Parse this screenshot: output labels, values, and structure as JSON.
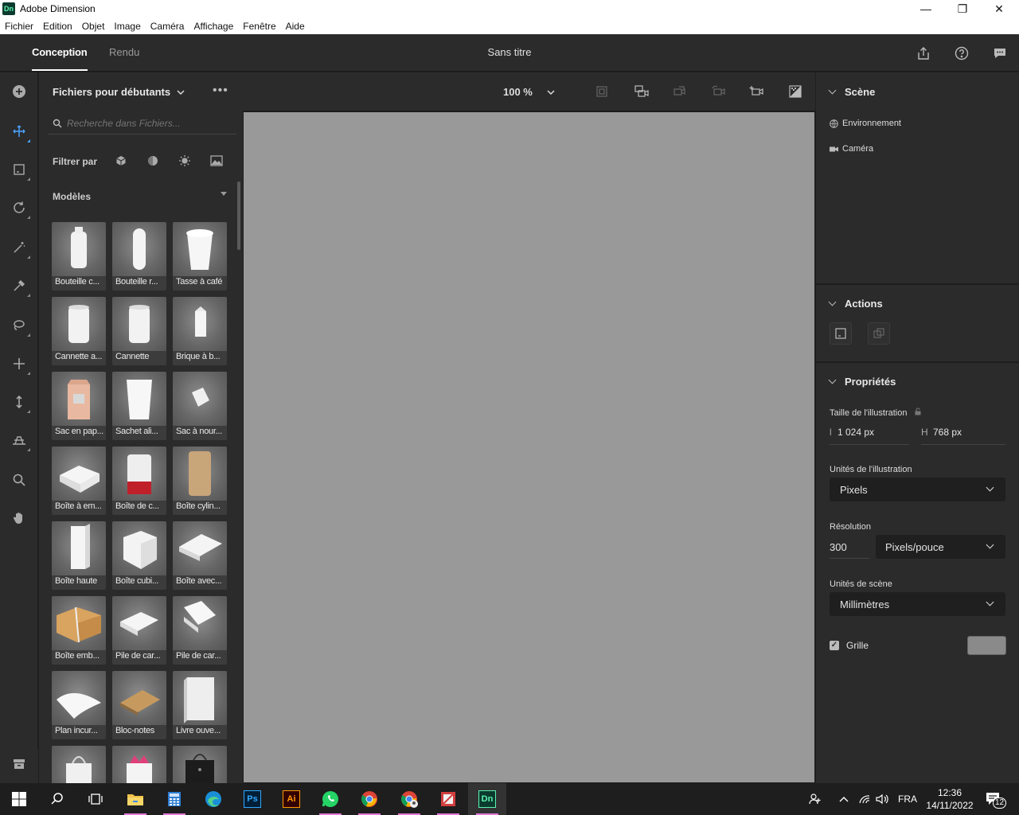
{
  "window": {
    "app_icon": "Dn",
    "title": "Adobe Dimension",
    "minimize_glyph": "—",
    "maximize_glyph": "❐",
    "close_glyph": "✕"
  },
  "menu": [
    "Fichier",
    "Edition",
    "Objet",
    "Image",
    "Caméra",
    "Affichage",
    "Fenêtre",
    "Aide"
  ],
  "header": {
    "tabs": [
      "Conception",
      "Rendu"
    ],
    "document_title": "Sans titre"
  },
  "left_panel": {
    "title": "Fichiers pour débutants",
    "search_placeholder": "Recherche dans Fichiers...",
    "filter_label": "Filtrer par",
    "section": "Modèles",
    "items": [
      {
        "label": "Bouteille c...",
        "shape": "bottle"
      },
      {
        "label": "Bouteille r...",
        "shape": "bottle-round"
      },
      {
        "label": "Tasse à café",
        "shape": "cup"
      },
      {
        "label": "Cannette a...",
        "shape": "can"
      },
      {
        "label": "Cannette",
        "shape": "can"
      },
      {
        "label": "Brique à b...",
        "shape": "carton"
      },
      {
        "label": "Sac en pap...",
        "shape": "paper-bag"
      },
      {
        "label": "Sachet ali...",
        "shape": "pouch"
      },
      {
        "label": "Sac à nour...",
        "shape": "sachet"
      },
      {
        "label": "Boîte à em...",
        "shape": "clamshell"
      },
      {
        "label": "Boîte de c...",
        "shape": "tin"
      },
      {
        "label": "Boîte cylin...",
        "shape": "tube"
      },
      {
        "label": "Boîte haute",
        "shape": "tall-box"
      },
      {
        "label": "Boîte cubi...",
        "shape": "cube"
      },
      {
        "label": "Boîte avec...",
        "shape": "flat-box"
      },
      {
        "label": "Boîte emb...",
        "shape": "parcel"
      },
      {
        "label": "Pile de car...",
        "shape": "cards"
      },
      {
        "label": "Pile de car...",
        "shape": "cards2"
      },
      {
        "label": "Plan incur...",
        "shape": "curved-plane"
      },
      {
        "label": "Bloc-notes",
        "shape": "notepad"
      },
      {
        "label": "Livre ouve...",
        "shape": "book"
      },
      {
        "label": "",
        "shape": "shopping-bag"
      },
      {
        "label": "",
        "shape": "gift-bag"
      },
      {
        "label": "",
        "shape": "black-bag"
      }
    ]
  },
  "viewport": {
    "zoom": "100 %"
  },
  "right_panel": {
    "scene": {
      "title": "Scène",
      "items": [
        "Environnement",
        "Caméra"
      ]
    },
    "actions": {
      "title": "Actions"
    },
    "properties": {
      "title": "Propriétés",
      "artboard_size_label": "Taille de l'illustration",
      "width_prefix": "l",
      "width_value": "1 024 px",
      "height_prefix": "H",
      "height_value": "768 px",
      "artboard_units_label": "Unités de l'illustration",
      "artboard_units_value": "Pixels",
      "resolution_label": "Résolution",
      "resolution_value": "300",
      "resolution_unit": "Pixels/pouce",
      "scene_units_label": "Unités de scène",
      "scene_units_value": "Millimètres",
      "grid_label": "Grille",
      "grid_checked": true
    }
  },
  "taskbar": {
    "apps": [
      "start",
      "search",
      "task-view",
      "file-explorer",
      "calculator",
      "edge",
      "photoshop",
      "illustrator",
      "whatsapp",
      "chrome",
      "chrome-profile",
      "snip",
      "dimension"
    ],
    "ps_label": "Ps",
    "ai_label": "Ai",
    "dn_label": "Dn",
    "language": "FRA",
    "time": "12:36",
    "date": "14/11/2022",
    "notifications": "12"
  },
  "colors": {
    "accent": "#4aa3ff",
    "canvas": "#999999",
    "panel": "#2b2b2b",
    "taskbar_indicator": "#e47ad8"
  }
}
